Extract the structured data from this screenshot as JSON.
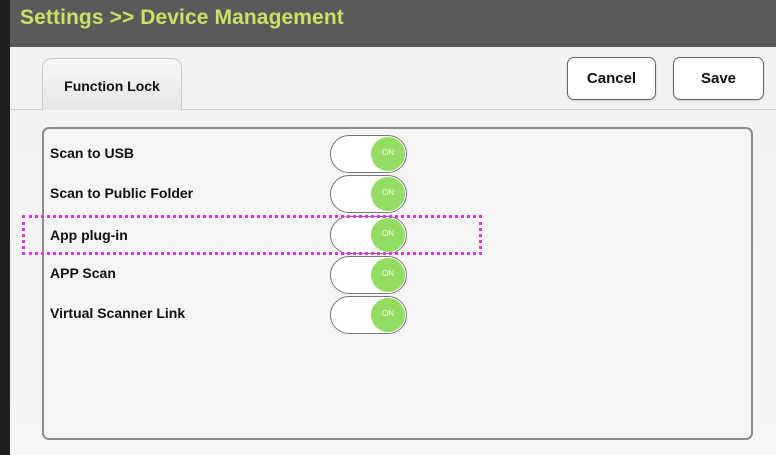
{
  "header": {
    "title": "Settings >> Device Management"
  },
  "tabs": [
    {
      "label": "Function Lock"
    }
  ],
  "toolbar": {
    "cancel_label": "Cancel",
    "save_label": "Save"
  },
  "settings": [
    {
      "label": "Scan to USB",
      "state": "ON"
    },
    {
      "label": "Scan to Public Folder",
      "state": "ON"
    },
    {
      "label": "App plug-in",
      "state": "ON"
    },
    {
      "label": "APP Scan",
      "state": "ON"
    },
    {
      "label": "Virtual Scanner Link",
      "state": "ON"
    }
  ],
  "colors": {
    "title_text": "#c9e265",
    "toggle_on": "#93dd63",
    "highlight": "#e233e8"
  },
  "highlighted_item": "App plug-in"
}
